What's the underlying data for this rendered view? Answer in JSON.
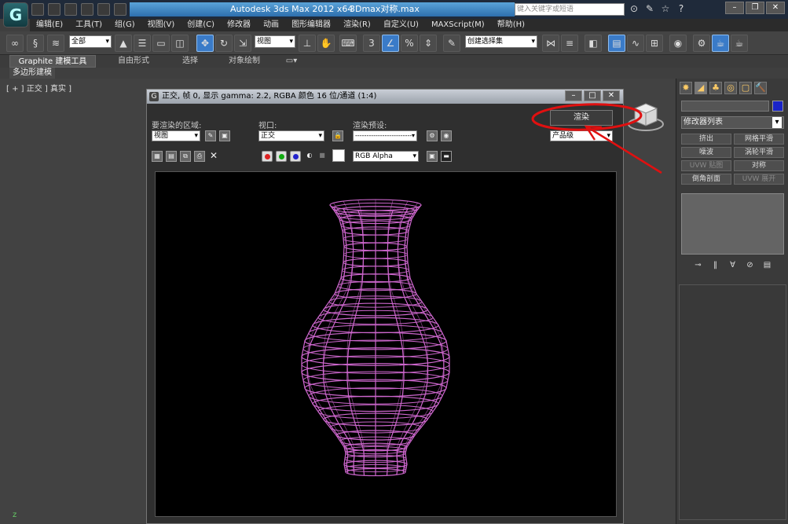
{
  "app": {
    "title": "Autodesk 3ds Max  2012 x64",
    "file": "3Dmax对称.max",
    "logo": "G",
    "search_placeholder": "键入关键字或短语"
  },
  "menu": [
    "编辑(E)",
    "工具(T)",
    "组(G)",
    "视图(V)",
    "创建(C)",
    "修改器",
    "动画",
    "图形编辑器",
    "渲染(R)",
    "自定义(U)",
    "MAXScript(M)",
    "帮助(H)"
  ],
  "toolbar": {
    "selection_filter": "全部",
    "ref_coord": "视图",
    "named_selection": "创建选择集"
  },
  "ribbon": {
    "tabs": [
      "Graphite 建模工具",
      "自由形式",
      "选择",
      "对象绘制"
    ],
    "sub_label": "多边形建模"
  },
  "viewport": {
    "label": "[ + ] 正交 ] 真实 ]"
  },
  "command_panel": {
    "modifier_list": "修改器列表",
    "buttons": [
      "挤出",
      "网格平滑",
      "噪波",
      "涡轮平滑",
      "UVW 贴图",
      "对称",
      "倒角剖面",
      "UVW 展开"
    ],
    "disabled": [
      false,
      false,
      false,
      false,
      true,
      false,
      false,
      true
    ]
  },
  "render_window": {
    "title": "正交, 帧 0, 显示 gamma: 2.2, RGBA 颜色 16 位/通道 (1:4)",
    "area_label": "要渲染的区域:",
    "area_value": "视图",
    "viewport_label": "视口:",
    "viewport_value": "正交",
    "preset_label": "渲染预设:",
    "preset_value": "-------------------------",
    "render_button": "渲染",
    "quality_value": "产品级",
    "channel_value": "RGB Alpha"
  },
  "colors": {
    "wire": "#cc66cc",
    "accent": "#3a7bc8",
    "annotation": "#e01010"
  }
}
